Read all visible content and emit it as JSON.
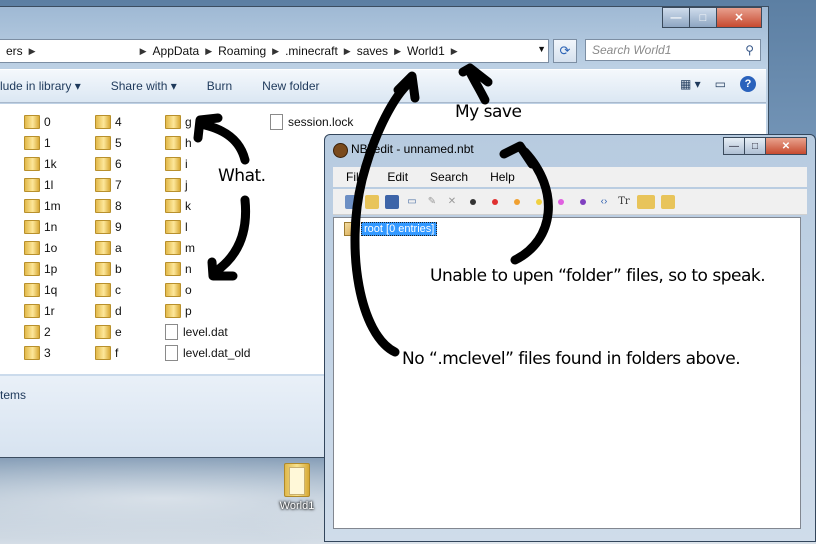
{
  "explorer": {
    "breadcrumb": [
      "ers",
      "AppData",
      "Roaming",
      ".minecraft",
      "saves",
      "World1"
    ],
    "search_placeholder": "Search World1",
    "toolbar": [
      "lude in library ▾",
      "Share with ▾",
      "Burn",
      "New folder"
    ],
    "status_text": "tems",
    "window_buttons": {
      "min": "—",
      "max": "□",
      "close": "✕"
    },
    "files": {
      "col1": [
        "0",
        "1",
        "1k",
        "1l",
        "1m",
        "1n",
        "1o",
        "1p",
        "1q",
        "1r",
        "2",
        "3"
      ],
      "col2": [
        "4",
        "5",
        "6",
        "7",
        "8",
        "9",
        "a",
        "b",
        "c",
        "d",
        "e",
        "f"
      ],
      "col3": [
        "g",
        "h",
        "i",
        "j",
        "k",
        "l",
        "m",
        "n",
        "o",
        "p"
      ],
      "col3_docs": [
        "level.dat",
        "level.dat_old"
      ],
      "col4_docs": [
        "session.lock"
      ]
    }
  },
  "desktop": {
    "icon_label": "World1"
  },
  "nbtedit": {
    "title": "NBTedit - unnamed.nbt",
    "menu": [
      "File",
      "Edit",
      "Search",
      "Help"
    ],
    "tree_root": "root [0 entries]",
    "window_buttons": {
      "min": "—",
      "max": "□",
      "close": "✕"
    }
  },
  "annotations": {
    "my_save": "My save",
    "what": "What.",
    "unable": "Unable to upen “folder” files, so to speak.",
    "no_mclevel": "No “.mclevel” files found in folders above."
  }
}
